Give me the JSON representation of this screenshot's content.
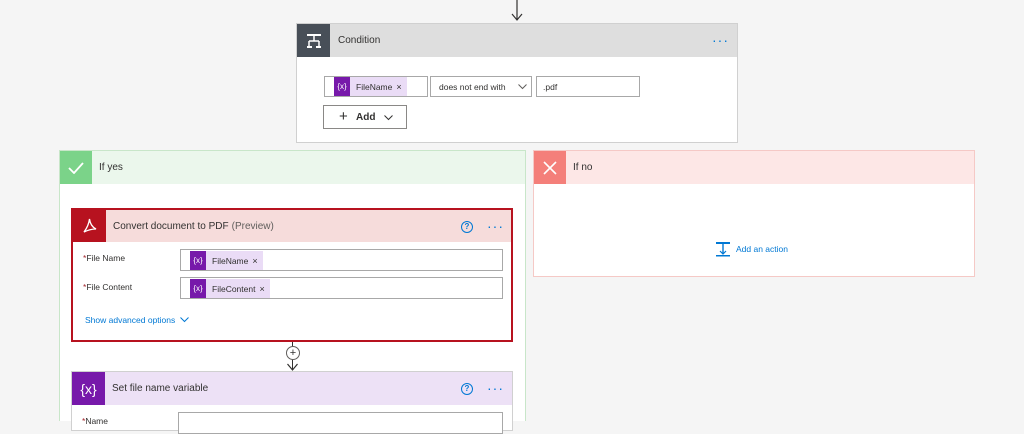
{
  "condition": {
    "title": "Condition",
    "more": "···",
    "token_label": "FileName",
    "token_icon": "{x}",
    "token_remove": "×",
    "operator": "does not end with",
    "value": ".pdf",
    "add_label": "Add",
    "add_plus": "+"
  },
  "branch_yes": {
    "title": "If yes"
  },
  "branch_no": {
    "title": "If no",
    "add_action": "Add an action"
  },
  "convert_action": {
    "title": "Convert document to PDF",
    "preview": "(Preview)",
    "help": "?",
    "more": "···",
    "fields": [
      {
        "required": "*",
        "label": "File Name",
        "token": "FileName"
      },
      {
        "required": "*",
        "label": "File Content",
        "token": "FileContent"
      }
    ],
    "token_icon": "{x}",
    "token_remove": "×",
    "advanced": "Show advanced options"
  },
  "connector": {
    "plus": "+"
  },
  "set_var_action": {
    "title": "Set file name variable",
    "icon": "{x}",
    "help": "?",
    "more": "···",
    "field_required": "*",
    "field_label": "Name"
  },
  "colors": {
    "condition_icon_bg": "#484f58",
    "yes_green": "#7bd389",
    "no_red": "#f47f7a",
    "pdf_red": "#b7121f",
    "variable_purple": "#7719aa",
    "accent_blue": "#0078d4"
  }
}
